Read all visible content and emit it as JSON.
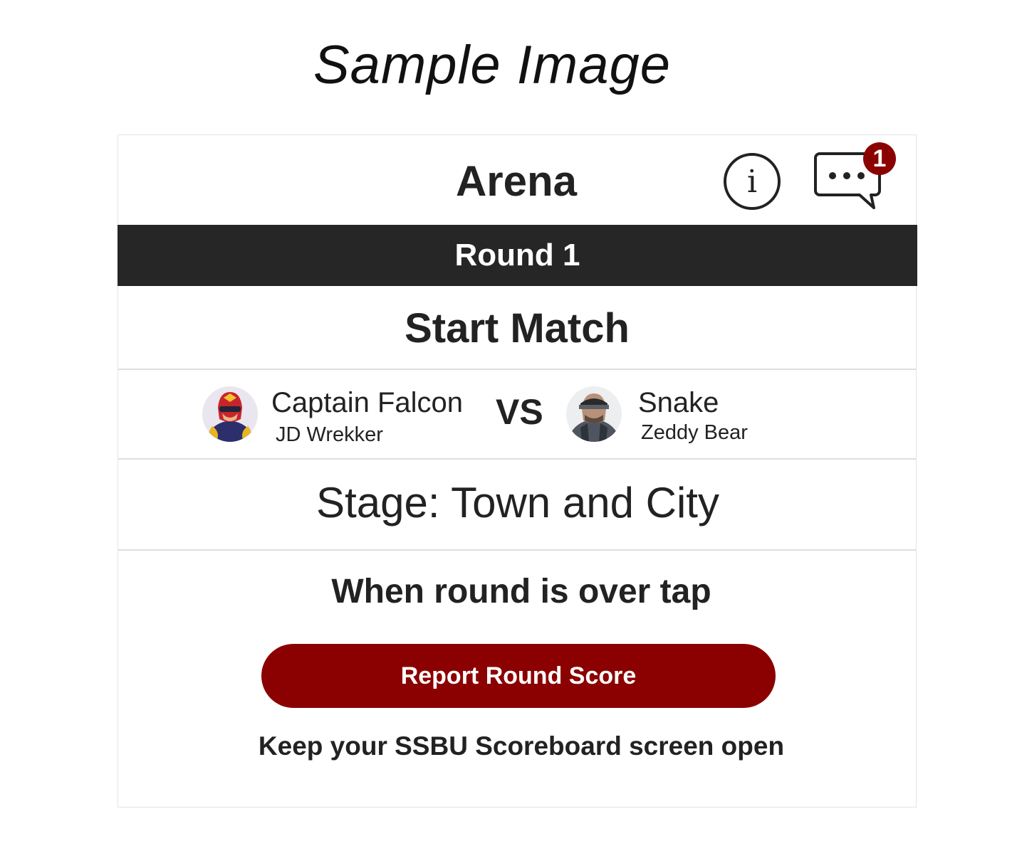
{
  "page_title": "Sample Image",
  "header": {
    "title": "Arena",
    "info_icon": "info-icon",
    "chat_icon": "chat-bubble-icon",
    "chat_badge_count": "1"
  },
  "round": {
    "label": "Round 1"
  },
  "match": {
    "start_label": "Start Match",
    "vs_label": "VS",
    "player1": {
      "character": "Captain Falcon",
      "player": "JD Wrekker",
      "avatar_icon": "captain-falcon-avatar"
    },
    "player2": {
      "character": "Snake",
      "player": "Zeddy Bear",
      "avatar_icon": "snake-avatar"
    }
  },
  "stage": {
    "text": "Stage: Town and City"
  },
  "report": {
    "instruction": "When round is over tap",
    "button_label": "Report Round Score",
    "footnote": "Keep your SSBU Scoreboard screen open"
  },
  "colors": {
    "accent": "#8b0000",
    "round_bar": "#262626",
    "text": "#222222",
    "divider": "#dedede"
  }
}
